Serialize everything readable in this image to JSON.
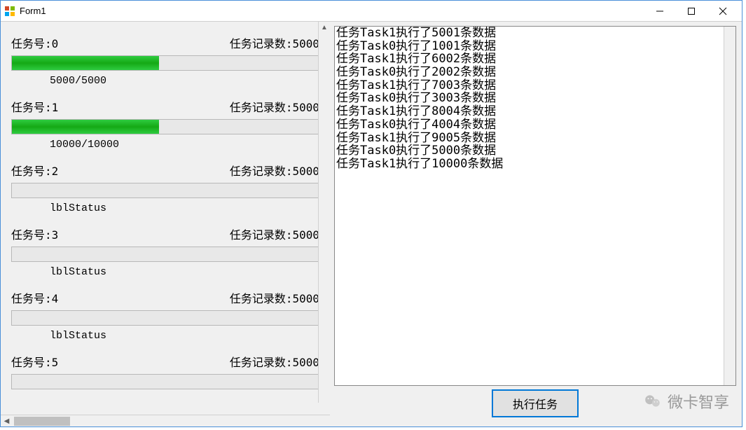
{
  "window": {
    "title": "Form1"
  },
  "tasks": [
    {
      "id_label": "任务号:0",
      "count_label": "任务记录数:5000",
      "progress_pct": 48,
      "status": "5000/5000"
    },
    {
      "id_label": "任务号:1",
      "count_label": "任务记录数:5000",
      "progress_pct": 48,
      "status": "10000/10000"
    },
    {
      "id_label": "任务号:2",
      "count_label": "任务记录数:5000",
      "progress_pct": 0,
      "status": "lblStatus"
    },
    {
      "id_label": "任务号:3",
      "count_label": "任务记录数:5000",
      "progress_pct": 0,
      "status": "lblStatus"
    },
    {
      "id_label": "任务号:4",
      "count_label": "任务记录数:5000",
      "progress_pct": 0,
      "status": "lblStatus"
    },
    {
      "id_label": "任务号:5",
      "count_label": "任务记录数:5000",
      "progress_pct": 0,
      "status": ""
    }
  ],
  "log_lines": [
    "任务Task1执行了5001条数据",
    "任务Task0执行了1001条数据",
    "任务Task1执行了6002条数据",
    "任务Task0执行了2002条数据",
    "任务Task1执行了7003条数据",
    "任务Task0执行了3003条数据",
    "任务Task1执行了8004条数据",
    "任务Task0执行了4004条数据",
    "任务Task1执行了9005条数据",
    "任务Task0执行了5000条数据",
    "任务Task1执行了10000条数据"
  ],
  "buttons": {
    "execute": "执行任务"
  },
  "watermark": {
    "text": "微卡智享"
  }
}
